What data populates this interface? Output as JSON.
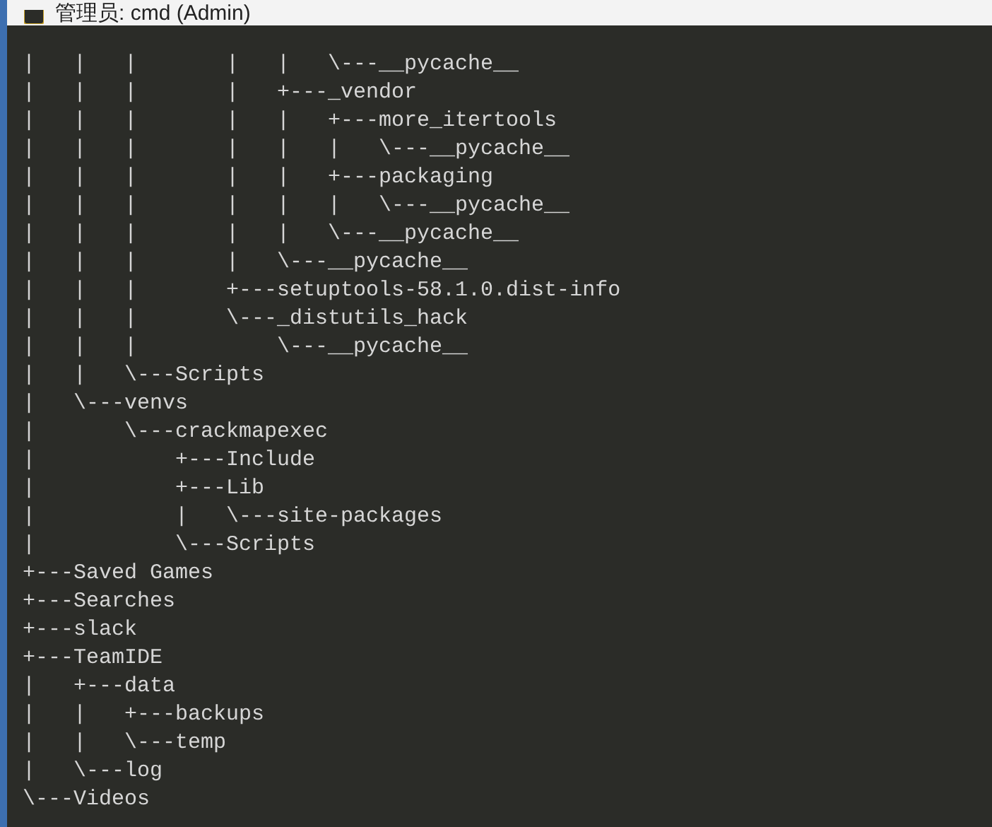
{
  "window": {
    "title": "管理员: cmd (Admin)"
  },
  "lines": [
    "|   |   |       |   |   \\---__pycache__",
    "|   |   |       |   +---_vendor",
    "|   |   |       |   |   +---more_itertools",
    "|   |   |       |   |   |   \\---__pycache__",
    "|   |   |       |   |   +---packaging",
    "|   |   |       |   |   |   \\---__pycache__",
    "|   |   |       |   |   \\---__pycache__",
    "|   |   |       |   \\---__pycache__",
    "|   |   |       +---setuptools-58.1.0.dist-info",
    "|   |   |       \\---_distutils_hack",
    "|   |   |           \\---__pycache__",
    "|   |   \\---Scripts",
    "|   \\---venvs",
    "|       \\---crackmapexec",
    "|           +---Include",
    "|           +---Lib",
    "|           |   \\---site-packages",
    "|           \\---Scripts",
    "+---Saved Games",
    "+---Searches",
    "+---slack",
    "+---TeamIDE",
    "|   +---data",
    "|   |   +---backups",
    "|   |   \\---temp",
    "|   \\---log",
    "\\---Videos"
  ]
}
